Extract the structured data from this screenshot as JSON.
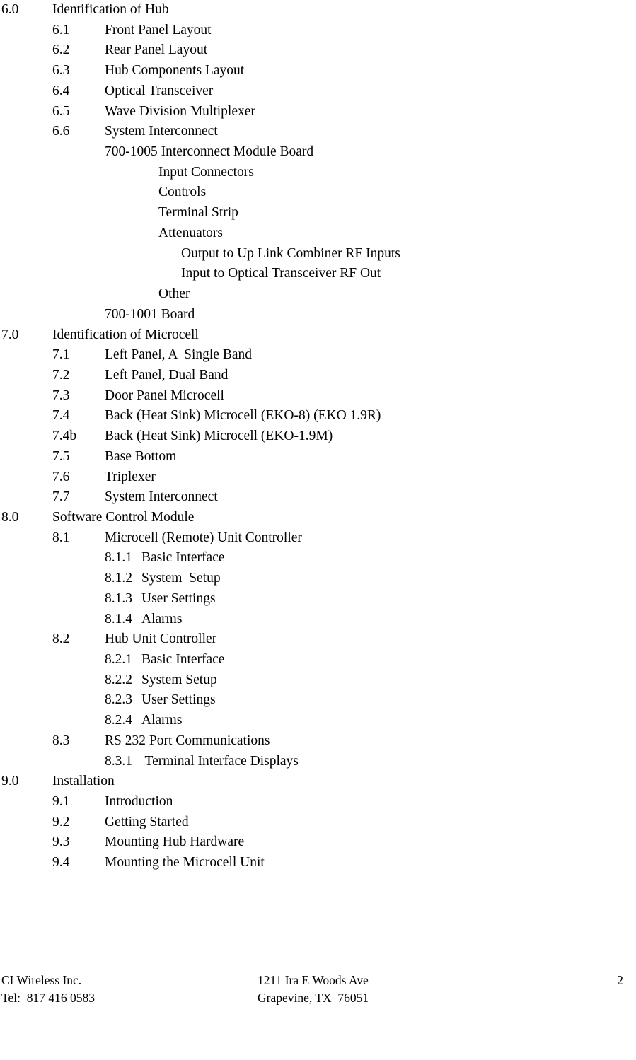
{
  "document": {
    "type": "table-of-contents",
    "page_number": "2"
  },
  "toc": {
    "entries": [
      {
        "number": "6.0",
        "text": "Identification of Hub",
        "level": 1
      },
      {
        "number": "6.1",
        "text": "Front Panel Layout",
        "level": 2
      },
      {
        "number": "6.2",
        "text": "Rear Panel Layout",
        "level": 2
      },
      {
        "number": "6.3",
        "text": "Hub Components Layout",
        "level": 2
      },
      {
        "number": "6.4",
        "text": "Optical Transceiver",
        "level": 2
      },
      {
        "number": "6.5",
        "text": "Wave Division Multiplexer",
        "level": 2
      },
      {
        "number": "6.6",
        "text": "System Interconnect",
        "level": 2
      },
      {
        "number": "",
        "text": "700-1005 Interconnect Module Board",
        "level": "2t"
      },
      {
        "number": "",
        "text": "Input Connectors",
        "level": "3t"
      },
      {
        "number": "",
        "text": "Controls",
        "level": "3t"
      },
      {
        "number": "",
        "text": "Terminal Strip",
        "level": "3t"
      },
      {
        "number": "",
        "text": "Attenuators",
        "level": "3t"
      },
      {
        "number": "",
        "text": "Output to Up Link Combiner RF Inputs",
        "level": "4t"
      },
      {
        "number": "",
        "text": "Input to Optical Transceiver RF Out",
        "level": "4t"
      },
      {
        "number": "",
        "text": "Other",
        "level": "3t"
      },
      {
        "number": "",
        "text": "700-1001 Board",
        "level": "2t"
      },
      {
        "number": "7.0",
        "text": "Identification of Microcell",
        "level": 1
      },
      {
        "number": "7.1",
        "text": "Left Panel, A  Single Band",
        "level": 2
      },
      {
        "number": "7.2",
        "text": "Left Panel, Dual Band",
        "level": 2
      },
      {
        "number": "7.3",
        "text": "Door Panel Microcell",
        "level": 2
      },
      {
        "number": "7.4",
        "text": "Back (Heat Sink) Microcell (EKO-8) (EKO 1.9R)",
        "level": 2
      },
      {
        "number": "7.4b",
        "text": "Back (Heat Sink) Microcell (EKO-1.9M)",
        "level": 2
      },
      {
        "number": "7.5",
        "text": "Base Bottom",
        "level": 2
      },
      {
        "number": "7.6",
        "text": "Triplexer",
        "level": 2
      },
      {
        "number": "7.7",
        "text": "System Interconnect",
        "level": 2
      },
      {
        "number": "8.0",
        "text": "Software Control Module",
        "level": 1
      },
      {
        "number": "8.1",
        "text": "Microcell (Remote) Unit Controller",
        "level": 2
      },
      {
        "number": "8.1.1",
        "text": "Basic Interface",
        "level": 3
      },
      {
        "number": "8.1.2",
        "text": "System  Setup",
        "level": 3
      },
      {
        "number": "8.1.3",
        "text": "User Settings",
        "level": 3
      },
      {
        "number": "8.1.4",
        "text": "Alarms",
        "level": 3
      },
      {
        "number": "8.2",
        "text": "Hub Unit Controller",
        "level": 2
      },
      {
        "number": "8.2.1",
        "text": "Basic Interface",
        "level": 3
      },
      {
        "number": "8.2.2",
        "text": "System Setup",
        "level": 3
      },
      {
        "number": "8.2.3",
        "text": "User Settings",
        "level": 3
      },
      {
        "number": "8.2.4",
        "text": "Alarms",
        "level": 3
      },
      {
        "number": "8.3",
        "text": "RS 232 Port Communications",
        "level": 2
      },
      {
        "number": "8.3.1",
        "text": " Terminal Interface Displays",
        "level": 3
      },
      {
        "number": "9.0",
        "text": "Installation",
        "level": 1
      },
      {
        "number": "9.1",
        "text": "Introduction",
        "level": 2
      },
      {
        "number": "9.2",
        "text": "Getting Started",
        "level": 2
      },
      {
        "number": "9.3",
        "text": "Mounting Hub Hardware",
        "level": 2
      },
      {
        "number": "9.4",
        "text": "Mounting the Microcell Unit",
        "level": 2
      }
    ]
  },
  "footer": {
    "company": "CI Wireless Inc.",
    "phone": "Tel:  817 416 0583",
    "address_line1": "1211 Ira E Woods Ave",
    "address_line2": "Grapevine, TX  76051",
    "page_number": "2"
  }
}
